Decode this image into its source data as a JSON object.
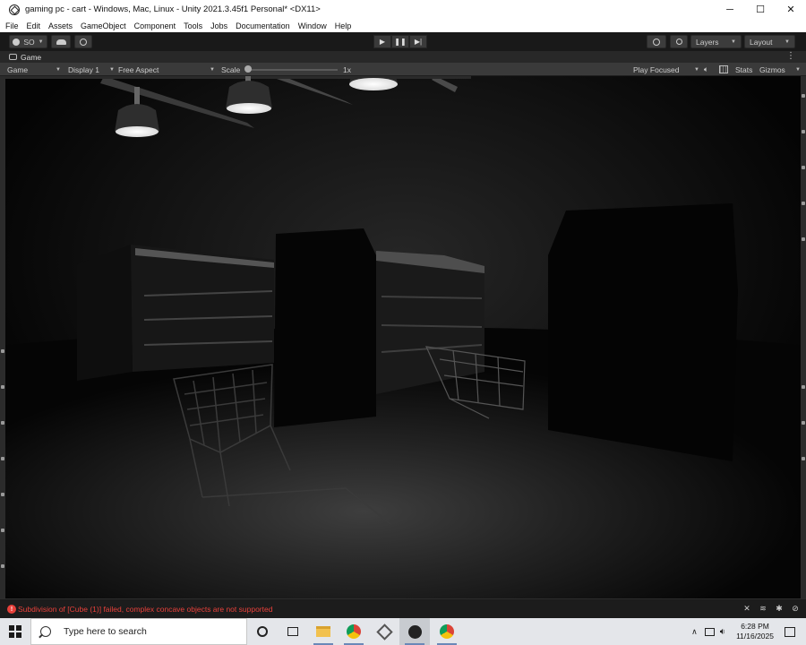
{
  "window": {
    "title": "gaming pc - cart - Windows, Mac, Linux - Unity 2021.3.45f1 Personal* <DX11>",
    "minimize": "─",
    "maximize": "☐",
    "close": "✕"
  },
  "menu": [
    "File",
    "Edit",
    "Assets",
    "GameObject",
    "Component",
    "Tools",
    "Jobs",
    "Documentation",
    "Window",
    "Help"
  ],
  "toolbar": {
    "account": "SO",
    "layers": "Layers",
    "layout": "Layout"
  },
  "tab": {
    "label": "Game"
  },
  "game_toolbar": {
    "mode": "Game",
    "display": "Display 1",
    "aspect": "Free Aspect",
    "scale_label": "Scale",
    "scale_value": "1x",
    "play_mode": "Play Focused",
    "stats": "Stats",
    "gizmos": "Gizmos"
  },
  "status": {
    "error_message": "Subdivision of [Cube (1)] failed, complex concave objects are not supported",
    "error_color": "#e8413b"
  },
  "taskbar": {
    "search_placeholder": "Type here to search",
    "time": "6:28 PM",
    "date": "11/16/2025"
  }
}
